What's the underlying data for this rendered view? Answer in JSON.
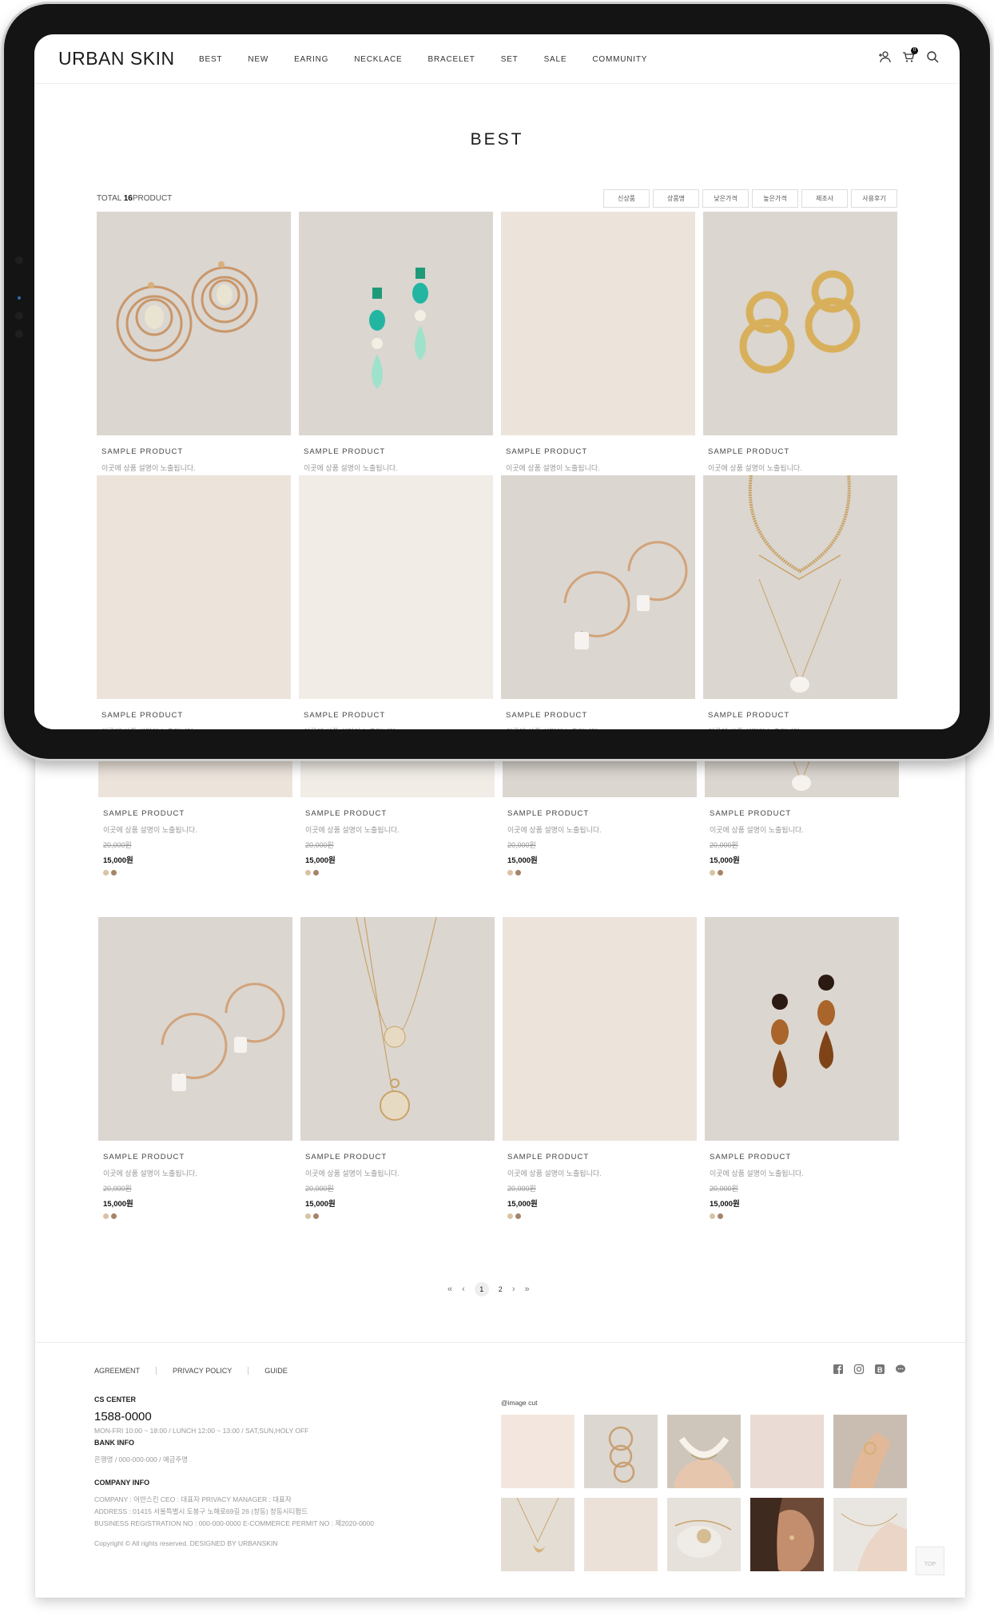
{
  "header": {
    "logo": "URBAN SKIN",
    "nav": [
      "BEST",
      "NEW",
      "EARING",
      "NECKLACE",
      "BRACELET",
      "SET",
      "SALE",
      "COMMUNITY"
    ],
    "icons": [
      "user-icon",
      "cart-icon",
      "search-icon"
    ],
    "cart_count": "0"
  },
  "page": {
    "title": "BEST",
    "total_prefix": "TOTAL",
    "total_count": "16",
    "total_suffix": "PRODUCT",
    "sort_options": [
      "신상품",
      "상품명",
      "낮은가격",
      "높은가격",
      "제조사",
      "사용후기"
    ]
  },
  "products": {
    "name": "SAMPLE PRODUCT",
    "desc": "이곳에 상품 설명이 노출됩니다.",
    "old_price": "20,000원",
    "price": "15,000원",
    "swatch_colors": [
      "#d9c3a5",
      "#a68466"
    ]
  },
  "pagination": {
    "first": "«",
    "prev": "‹",
    "pages": [
      "1",
      "2"
    ],
    "current": "1",
    "next": "›",
    "last": "»"
  },
  "footer": {
    "links": [
      "AGREEMENT",
      "PRIVACY POLICY",
      "GUIDE"
    ],
    "social_icons": [
      "facebook-icon",
      "instagram-icon",
      "blog-icon",
      "talk-icon"
    ],
    "cs_title": "CS CENTER",
    "cs_phone": "1588-0000",
    "cs_hours": "MON-FRI 10:00 ~ 18:00 / LUNCH 12:00 ~ 13:00 / SAT,SUN,HOLY OFF",
    "bank_title": "BANK INFO",
    "bank_text": "은행명 / 000-000-000 / 예금주명",
    "company_title": "COMPANY INFO",
    "company_line1": "COMPANY : 어반스킨 CEO : 대표자 PRIVACY MANAGER : 대표자",
    "company_line2": "ADDRESS : 01415 서울특별시 도봉구 노해로69길 26 (창동) 창동시티펌드",
    "company_line3": "BUSINESS REGISTRATION NO : 000-000-0000 E-COMMERCE PERMIT NO : 제2020-0000",
    "copyright": "Copyright © All rights reserved. DESIGNED BY URBANSKIN",
    "insta_title": "@image cut",
    "top_label": "TOP"
  }
}
